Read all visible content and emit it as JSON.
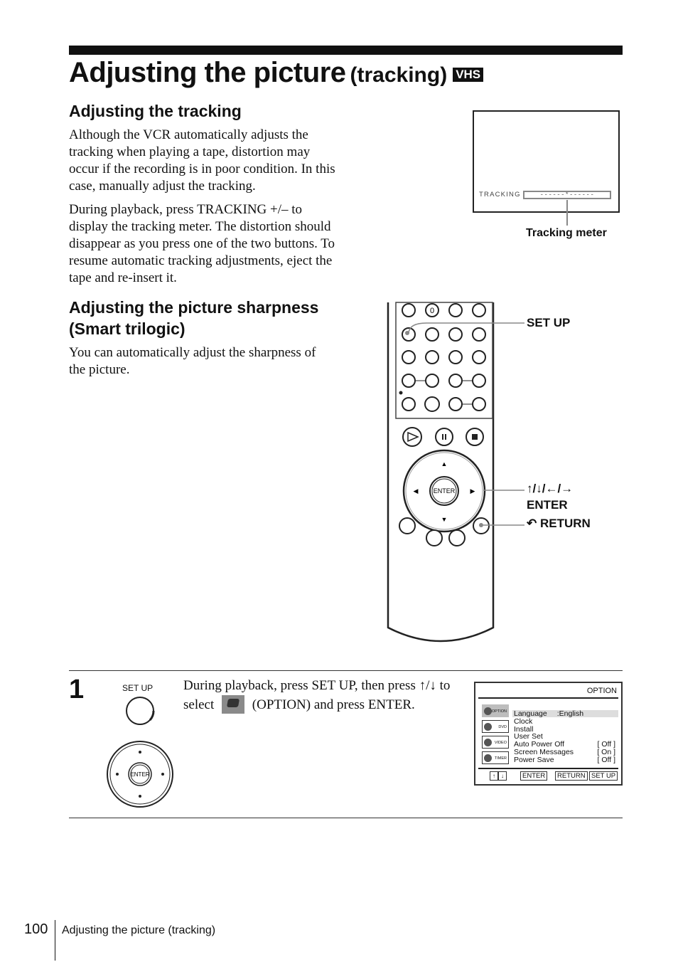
{
  "header": {
    "title_main": "Adjusting the picture",
    "title_sub": "(tracking)",
    "badge": "VHS"
  },
  "sections": [
    {
      "title": "Adjusting the tracking",
      "paragraphs": [
        "Although the VCR automatically adjusts the tracking when playing a tape, distortion may occur if the recording is in poor condition.  In this case, manually adjust the tracking.",
        "During playback, press TRACKING +/– to display the tracking meter.  The distortion should disappear as you press one of the two buttons.  To resume automatic tracking adjustments, eject the tape and re-insert it."
      ]
    },
    {
      "title": "Adjusting the picture sharpness (Smart trilogic)",
      "paragraphs": [
        "You can automatically adjust the sharpness of the picture."
      ]
    }
  ],
  "tracking_screen": {
    "label": "TRACKING",
    "meter": "------*------",
    "caption": "Tracking meter"
  },
  "remote_callouts": {
    "setup": "SET UP",
    "arrows": "↑/↓/←/→",
    "enter": "ENTER",
    "return_icon": "return-icon",
    "return": "RETURN",
    "zero_key": "0",
    "enter_key": "ENTER"
  },
  "step": {
    "number": "1",
    "setup_button_label": "SET UP",
    "dpad_center": "ENTER",
    "text_part1": "During playback, press SET UP, then press",
    "text_arrows": "↑/↓",
    "text_part2": " to select ",
    "text_part3": " (OPTION) and press ENTER.",
    "option_icon": "option-icon"
  },
  "option_menu": {
    "title": "OPTION",
    "tabs": [
      "OPTION",
      "DVD",
      "VIDEO",
      "TIMER"
    ],
    "selected_tab": "OPTION",
    "rows": [
      {
        "label": "Language",
        "value": ":English",
        "highlight": true
      },
      {
        "label": "Clock",
        "value": ""
      },
      {
        "label": "Install",
        "value": ""
      },
      {
        "label": "User Set",
        "value": ""
      },
      {
        "label": "Auto Power Off",
        "value": "[ Off ]"
      },
      {
        "label": "Screen Messages",
        "value": "[ On ]"
      },
      {
        "label": "Power Save",
        "value": "[ Off ]"
      }
    ],
    "footer": {
      "up": "↑",
      "down": "↓",
      "enter": "ENTER",
      "return": "RETURN",
      "setup": "SET UP"
    }
  },
  "footer": {
    "page_number": "100",
    "running_title": "Adjusting the picture (tracking)"
  }
}
